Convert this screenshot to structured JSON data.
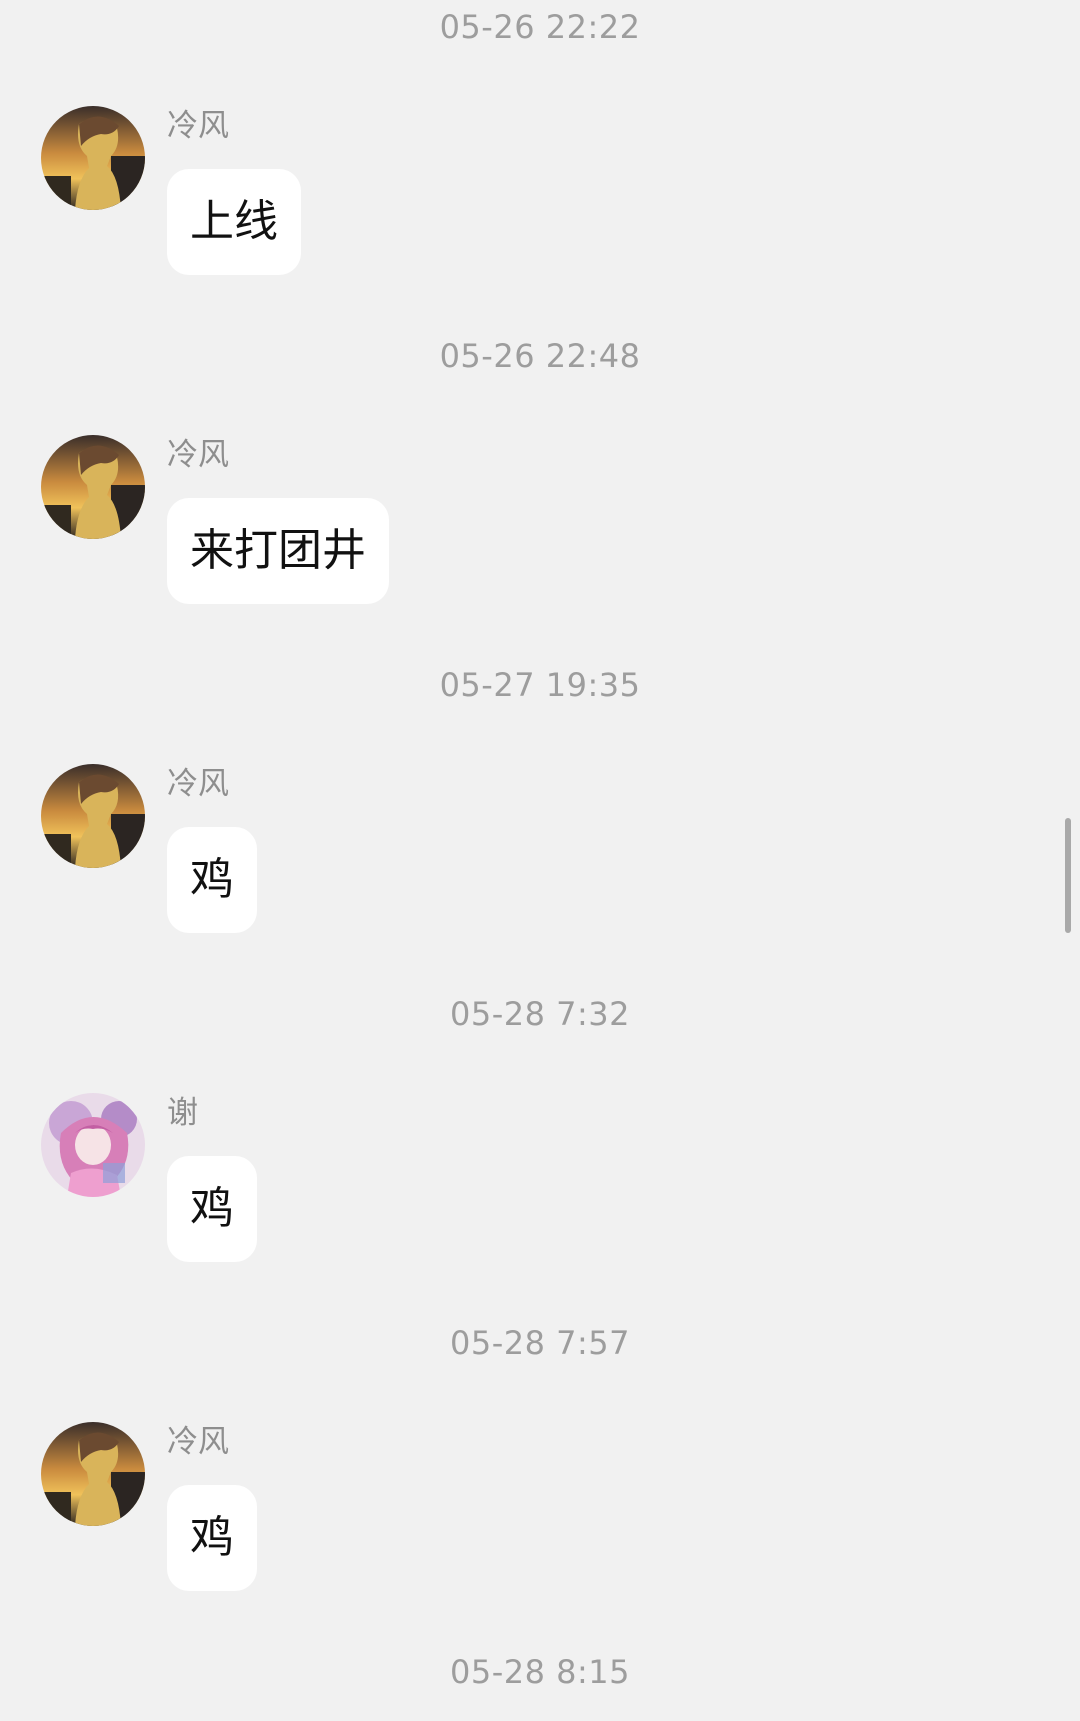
{
  "colors": {
    "background": "#f1f1f1",
    "bubble": "#ffffff",
    "timestamp_text": "#9d9d9d",
    "sender_text": "#8e8e8e",
    "message_text": "#111111"
  },
  "messages": [
    {
      "timestamp": "05-26 22:22",
      "sender": "冷风",
      "text": "上线",
      "avatar_icon": "sunset-boy-avatar-icon"
    },
    {
      "timestamp": "05-26 22:48",
      "sender": "冷风",
      "text": "来打团井",
      "avatar_icon": "sunset-boy-avatar-icon"
    },
    {
      "timestamp": "05-27 19:35",
      "sender": "冷风",
      "text": "鸡",
      "avatar_icon": "sunset-boy-avatar-icon"
    },
    {
      "timestamp": "05-28 7:32",
      "sender": "谢",
      "text": "鸡",
      "avatar_icon": "anime-girl-avatar-icon"
    },
    {
      "timestamp": "05-28 7:57",
      "sender": "冷风",
      "text": "鸡",
      "avatar_icon": "sunset-boy-avatar-icon"
    }
  ],
  "trailing_timestamp": "05-28 8:15"
}
